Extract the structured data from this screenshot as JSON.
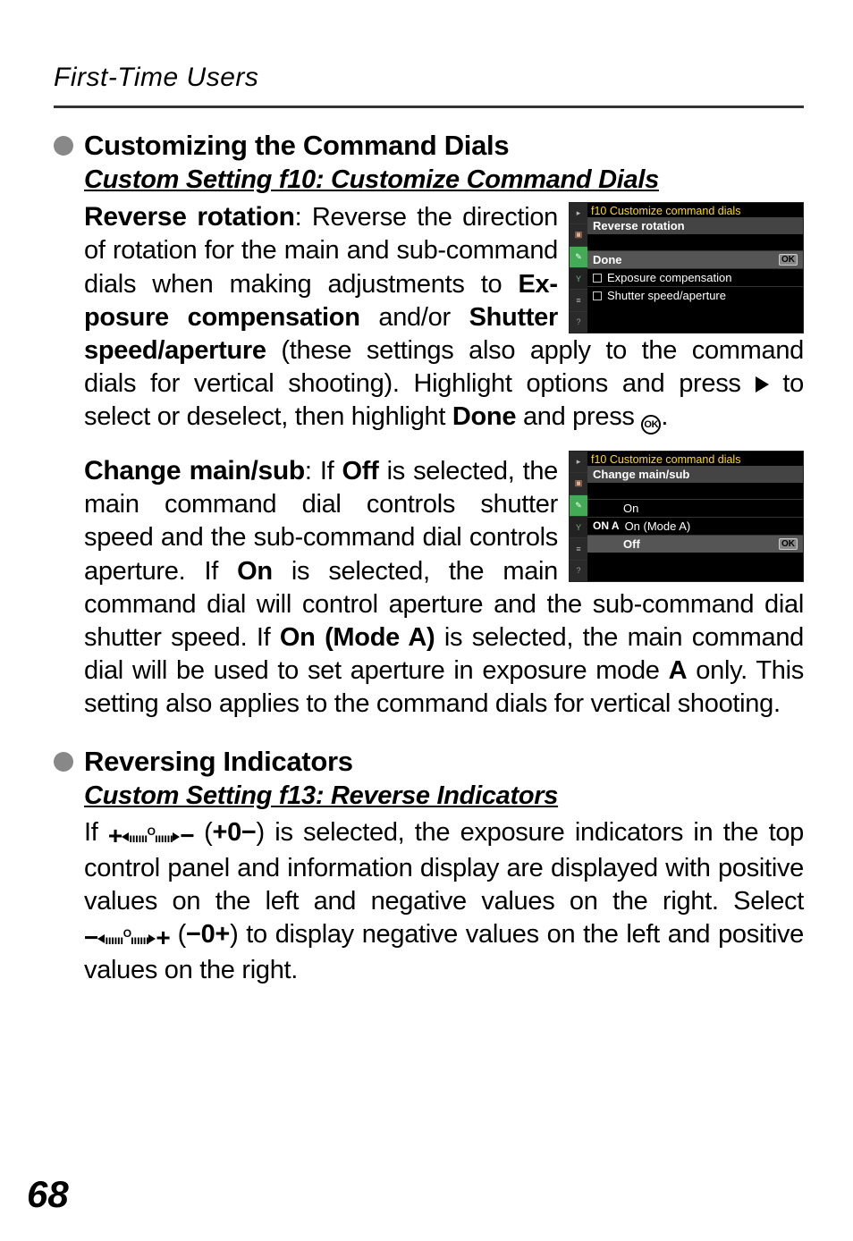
{
  "page": {
    "header": "First-Time Users",
    "pageNumber": "68"
  },
  "section1": {
    "title": "Customizing the Command Dials",
    "subtitle": "Custom Setting f10: Customize Command Dials",
    "para1": {
      "label": "Reverse rotation",
      "sep": ": ",
      "t1": "Reverse the direction of rotation for the main and sub-command dials when making adjustments to ",
      "b1": "Ex­posure compensation",
      "t2": " and/or ",
      "b2": "Shutter speed/aperture",
      "t3": " (these settings also ap­ply to the command dials for vertical shooting). Highlight options and press ",
      "t4": " to select or deselect, then highlight ",
      "b3": "Done",
      "t5": " and press ",
      "t6": "."
    },
    "para2": {
      "label": "Change main/sub",
      "sep": ": ",
      "t1": "If ",
      "b1": "Off",
      "t2": " is selected, the main command dial controls shutter speed and the sub-command dial con­trols aperture. If ",
      "b2": "On",
      "t3": " is selected, the main command dial will control aperture and the sub-command dial shutter speed. If ",
      "b3": "On (Mode A)",
      "t4": " is se­lected, the main command dial will be used to set aperture in exposure mode ",
      "modeA": "A",
      "t5": " only. This setting also applies to the command dials for vertical shooting."
    }
  },
  "section2": {
    "title": "Reversing Indicators",
    "subtitle": "Custom Setting f13: Reverse Indicators",
    "para": {
      "t1": "If ",
      "paren1a": " (",
      "paren1b": ")",
      "sym1": "+0−",
      "t2": " is selected, the exposure indicators in the top control panel and information display are dis­played with positive values on the left and negative values on the right. Select ",
      "paren2a": " (",
      "paren2b": ")",
      "sym2": "−0+",
      "t3": " to display nega­tive values on the left and positive values on the right."
    }
  },
  "screenshot1": {
    "titlePrefix": "f10",
    "title": "Customize command dials",
    "subtitle": "Reverse rotation",
    "row_done": "Done",
    "ok": "OK",
    "row_exp": "Exposure compensation",
    "row_shutter": "Shutter speed/aperture"
  },
  "screenshot2": {
    "titlePrefix": "f10",
    "title": "Customize command dials",
    "subtitle": "Change main/sub",
    "row_on": "On",
    "row_onA_pre": "ON A",
    "row_onA": "On (Mode A)",
    "row_off": "Off",
    "ok": "OK"
  }
}
